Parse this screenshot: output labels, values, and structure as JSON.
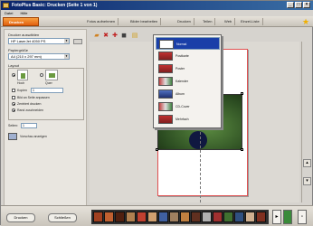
{
  "titlebar": {
    "title": "FotoPlus Basic: Drucken (Seite 1 von 1)",
    "min": "_",
    "max": "□",
    "close": "×"
  },
  "menubar": {
    "items": [
      "Datei",
      "Hilfe"
    ]
  },
  "tabs": {
    "active": "Drucken",
    "items": [
      "Fotos aufnehmen",
      "Bilder bearbeiten",
      "Drucken",
      "Teilen",
      "Web",
      "Einzel-Liste"
    ]
  },
  "left": {
    "printer_label": "Drucker auswählen",
    "printer_value": "HP LaserJet 4050 PS",
    "paper_label": "Papiergröße",
    "paper_value": "A4 (210 x 297 mm)",
    "layout_label": "Layout",
    "orient_options": [
      "Hoch",
      "Quer"
    ],
    "copies_label": "Kopien",
    "copies_value": "1",
    "check_fit": "Bild an Seite anpassen",
    "check_center": "Zentriert drucken",
    "check_crop": "Rand zuschneiden",
    "pages_label": "Seiten:",
    "pages_value": "1",
    "preview_label": "Vorschau anzeigen"
  },
  "toolbar": {
    "icons": [
      "open-icon",
      "delete-icon",
      "add-icon",
      "text-icon",
      "frame-icon"
    ]
  },
  "dropdown": {
    "items": [
      {
        "label": "Normal",
        "icon": "normal-layout-icon",
        "selected": true
      },
      {
        "label": "Postkarte",
        "icon": "postcard-icon",
        "selected": false
      },
      {
        "label": "Poster",
        "icon": "poster-icon",
        "selected": false
      },
      {
        "label": "Kalender",
        "icon": "calendar-icon",
        "selected": false
      },
      {
        "label": "Album",
        "icon": "album-icon",
        "selected": false
      },
      {
        "label": "CD-Cover",
        "icon": "cd-cover-icon",
        "selected": false
      },
      {
        "label": "Mehrfach",
        "icon": "multi-icon",
        "selected": false
      }
    ]
  },
  "bottom": {
    "print_button": "Drucken",
    "close_button": "Schließen",
    "thumb_colors": [
      "#a04020",
      "#c06030",
      "#502010",
      "#b08050",
      "#c04030",
      "#d0a070",
      "#4060a0",
      "#a08060",
      "#c08040",
      "#603020",
      "#b0b0b0",
      "#a03030",
      "#407030",
      "#305080",
      "#d0b090",
      "#803020"
    ]
  }
}
